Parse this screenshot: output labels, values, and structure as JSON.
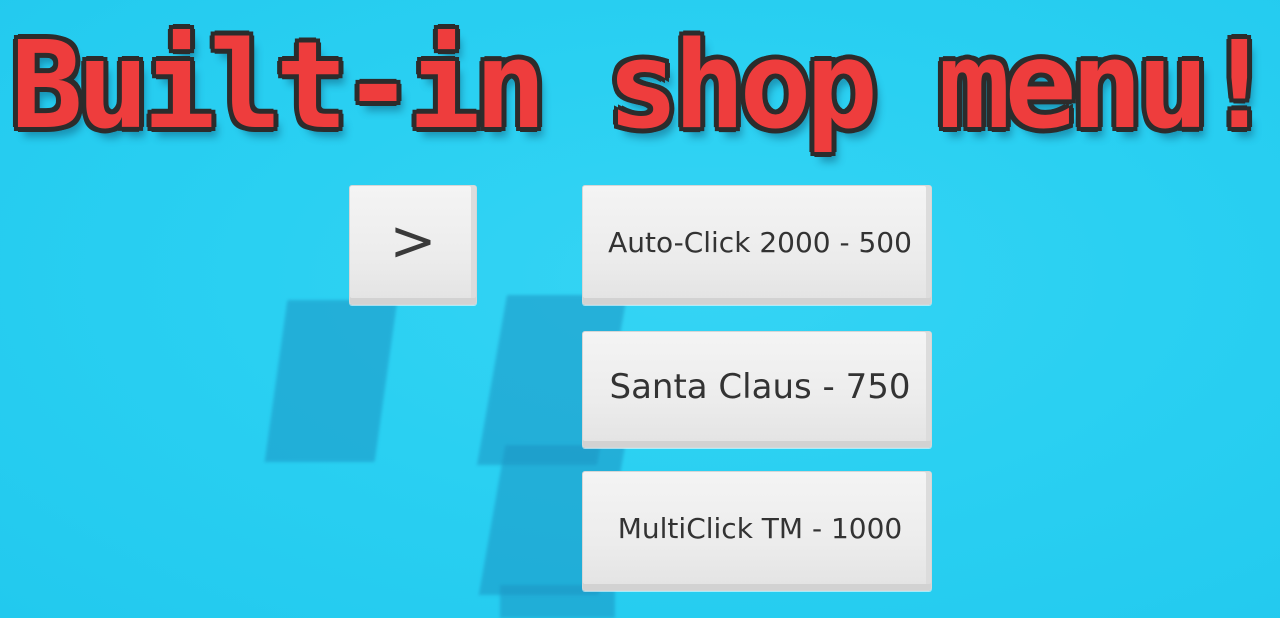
{
  "title": "Built-in shop menu!",
  "next_button": {
    "label": ">",
    "icon": "chevron-right-icon"
  },
  "shop_items": [
    {
      "label": "Auto-Click 2000 - 500"
    },
    {
      "label": "Santa Claus - 750"
    },
    {
      "label": "MultiClick TM - 1000"
    }
  ],
  "colors": {
    "background": "#2ad0f2",
    "title_fill": "#ee3d3d",
    "title_outline": "#2c2c2c",
    "button_face": "#eeeeee",
    "button_text": "#333333"
  }
}
